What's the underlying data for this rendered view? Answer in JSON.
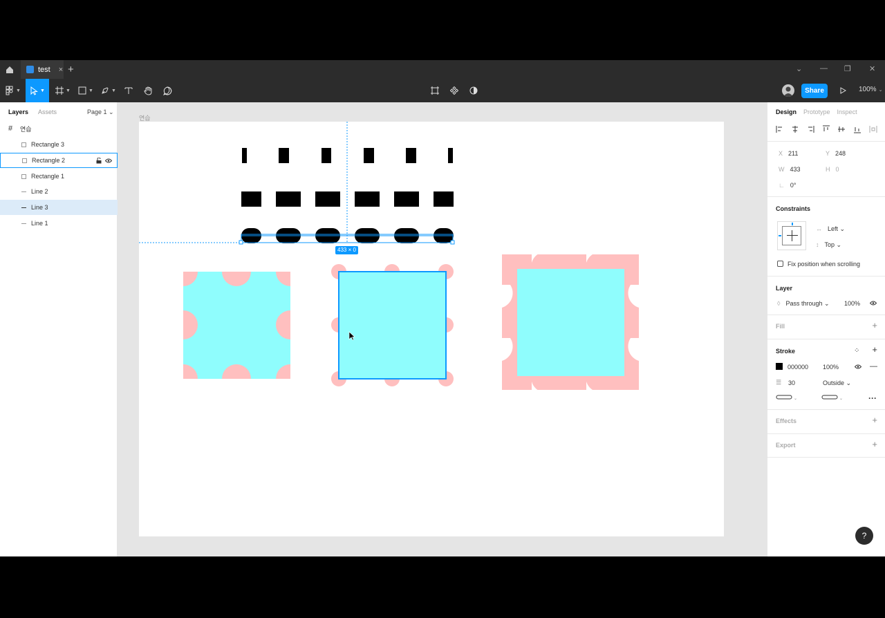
{
  "tabbar": {
    "file_tab": "test",
    "close_glyph": "×",
    "new_tab_glyph": "+",
    "window_controls": [
      "⌄",
      "—",
      "❐",
      "✕"
    ]
  },
  "toolbar": {
    "share_label": "Share",
    "zoom_label": "100%",
    "tools": [
      "main-menu",
      "move",
      "frame",
      "rectangle",
      "pen",
      "text",
      "hand",
      "comment"
    ],
    "center_tools": [
      "crop-icon",
      "component-icon",
      "contrast-icon"
    ]
  },
  "left_panel": {
    "tabs": [
      "Layers",
      "Assets"
    ],
    "page": "Page 1 ⌄",
    "frame_name": "연습",
    "layers": [
      {
        "label": "Rectangle 3",
        "kind": "rect"
      },
      {
        "label": "Rectangle 2",
        "kind": "rect"
      },
      {
        "label": "Rectangle 1",
        "kind": "rect"
      },
      {
        "label": "Line 2",
        "kind": "line"
      },
      {
        "label": "Line 3",
        "kind": "line"
      },
      {
        "label": "Line 1",
        "kind": "line"
      }
    ]
  },
  "canvas": {
    "frame_label": "연습",
    "selection_badge": "433 × 0",
    "colors": {
      "fill_cyan": "#8ffdfd",
      "dot_pink": "#ffbfbf",
      "selection_blue": "#0d99ff",
      "stroke_black": "#000000"
    }
  },
  "right_panel": {
    "tabs": [
      "Design",
      "Prototype",
      "Inspect"
    ],
    "x_label": "X",
    "x_value": "211",
    "y_label": "Y",
    "y_value": "248",
    "w_label": "W",
    "w_value": "433",
    "h_label": "H",
    "h_value": "0",
    "rotation": "0°",
    "constraints_title": "Constraints",
    "constraint_h": "Left",
    "constraint_v": "Top",
    "fix_position": "Fix position when scrolling",
    "layer_title": "Layer",
    "blend": "Pass through",
    "layer_opacity": "100%",
    "fill_title": "Fill",
    "stroke_title": "Stroke",
    "stroke_color": "000000",
    "stroke_opacity": "100%",
    "stroke_weight": "30",
    "stroke_align": "Outside",
    "effects_title": "Effects",
    "export_title": "Export"
  },
  "help_label": "?"
}
